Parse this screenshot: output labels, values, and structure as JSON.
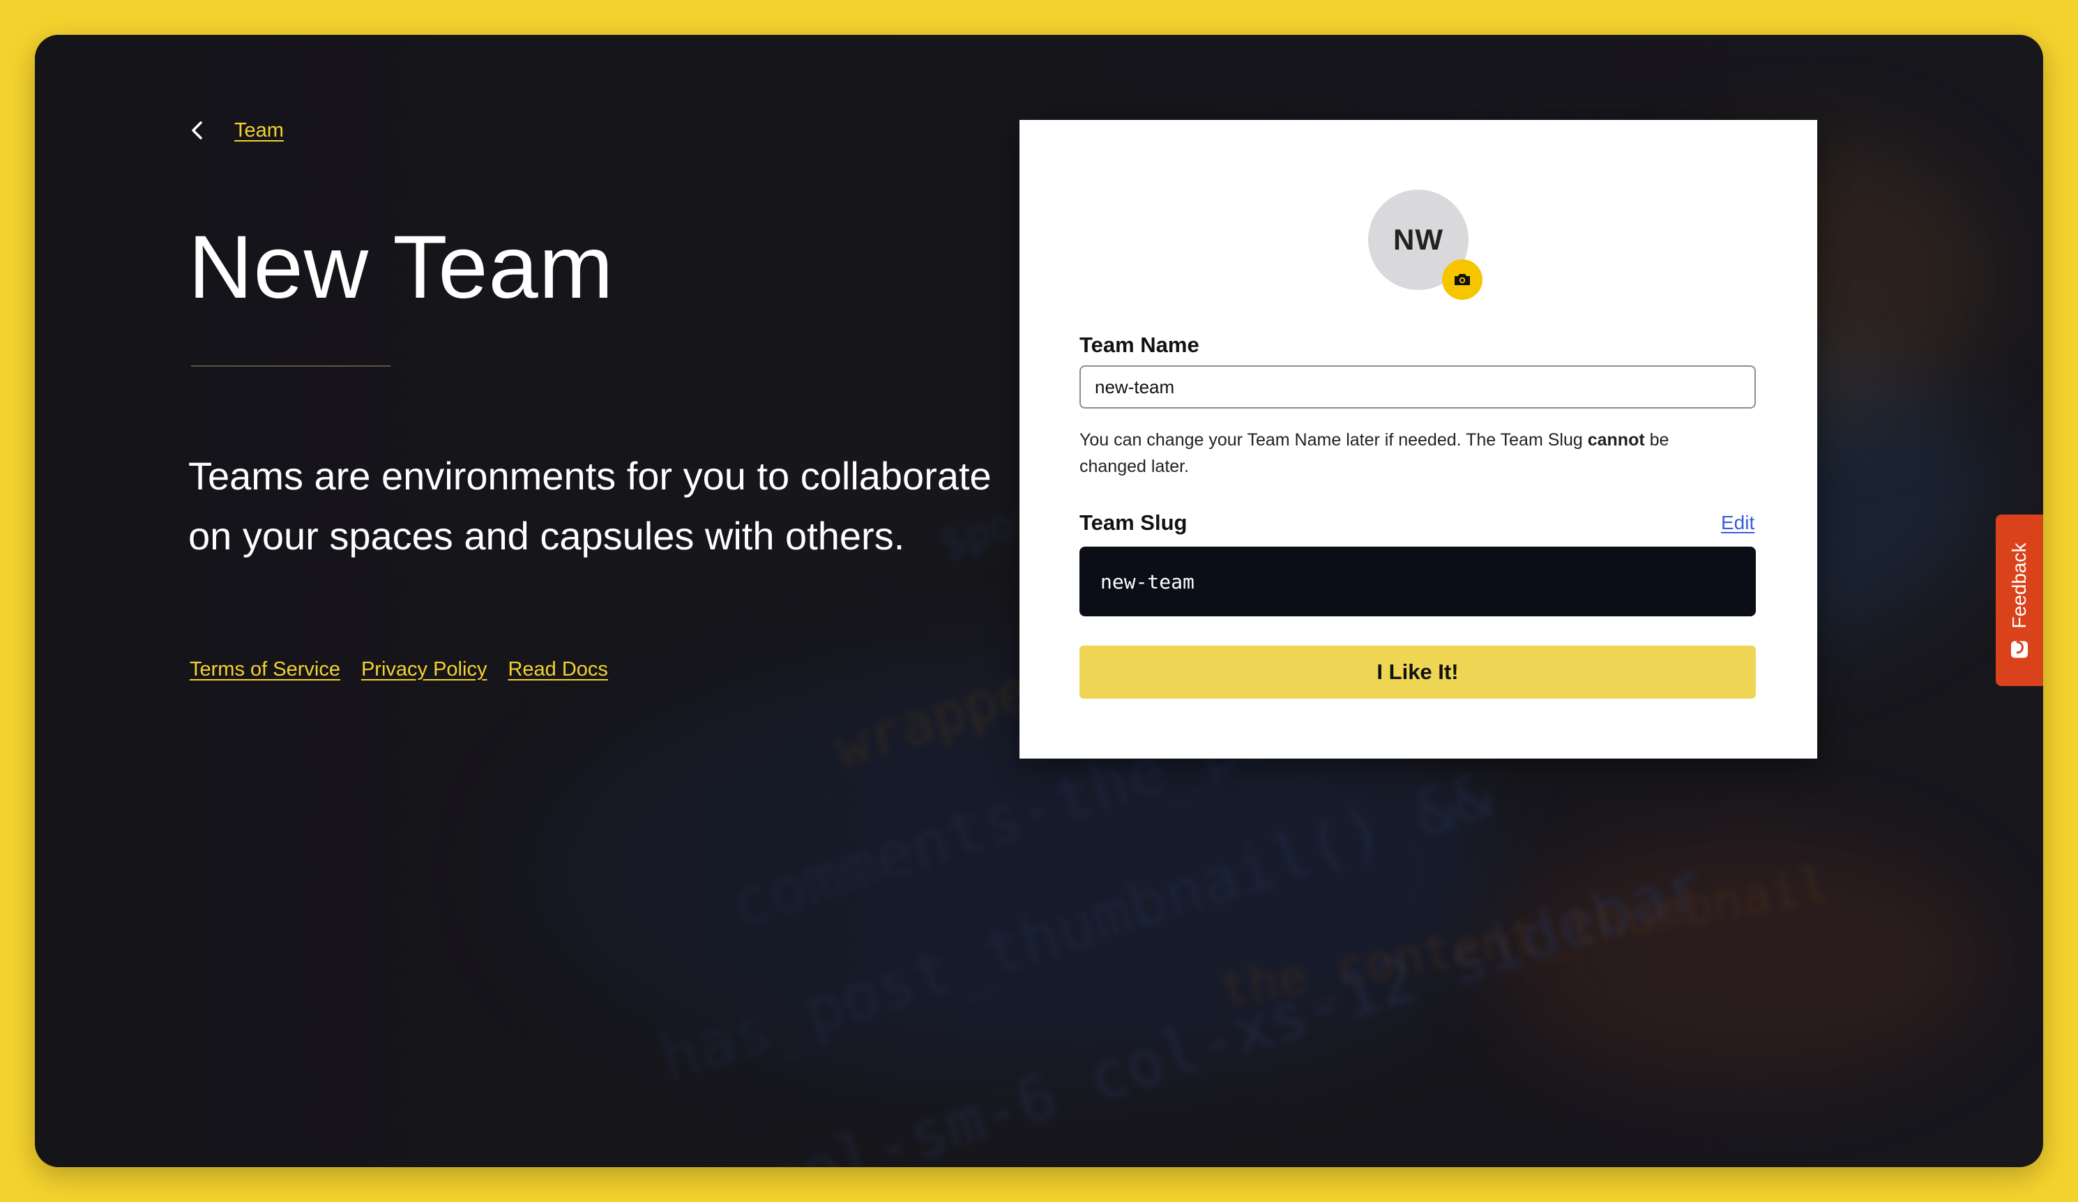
{
  "breadcrumb": {
    "back_icon": "chevron-left-icon",
    "label": "Team"
  },
  "page": {
    "title": "New Team",
    "intro": "Teams are environments for you to collaborate on your spaces and capsules with others."
  },
  "footer_links": {
    "terms": "Terms of Service",
    "privacy": "Privacy Policy",
    "docs": "Read Docs"
  },
  "card": {
    "avatar_initials": "NW",
    "avatar_upload_icon": "camera-icon",
    "team_name_label": "Team Name",
    "team_name_value": "new-team",
    "hint_before": "You can change your Team Name later if needed. The Team Slug ",
    "hint_emphasis": "cannot",
    "hint_after": " be changed later.",
    "team_slug_label": "Team Slug",
    "edit_label": "Edit",
    "team_slug_value": "new-team",
    "submit_label": "I Like It!"
  },
  "feedback": {
    "label": "Feedback",
    "icon": "smile-icon"
  },
  "colors": {
    "accent": "#f4d22e",
    "button": "#eed554",
    "slug_bg": "#0b0e16",
    "feedback_tab": "#d9421b",
    "link_blue": "#3b5bdb"
  }
}
